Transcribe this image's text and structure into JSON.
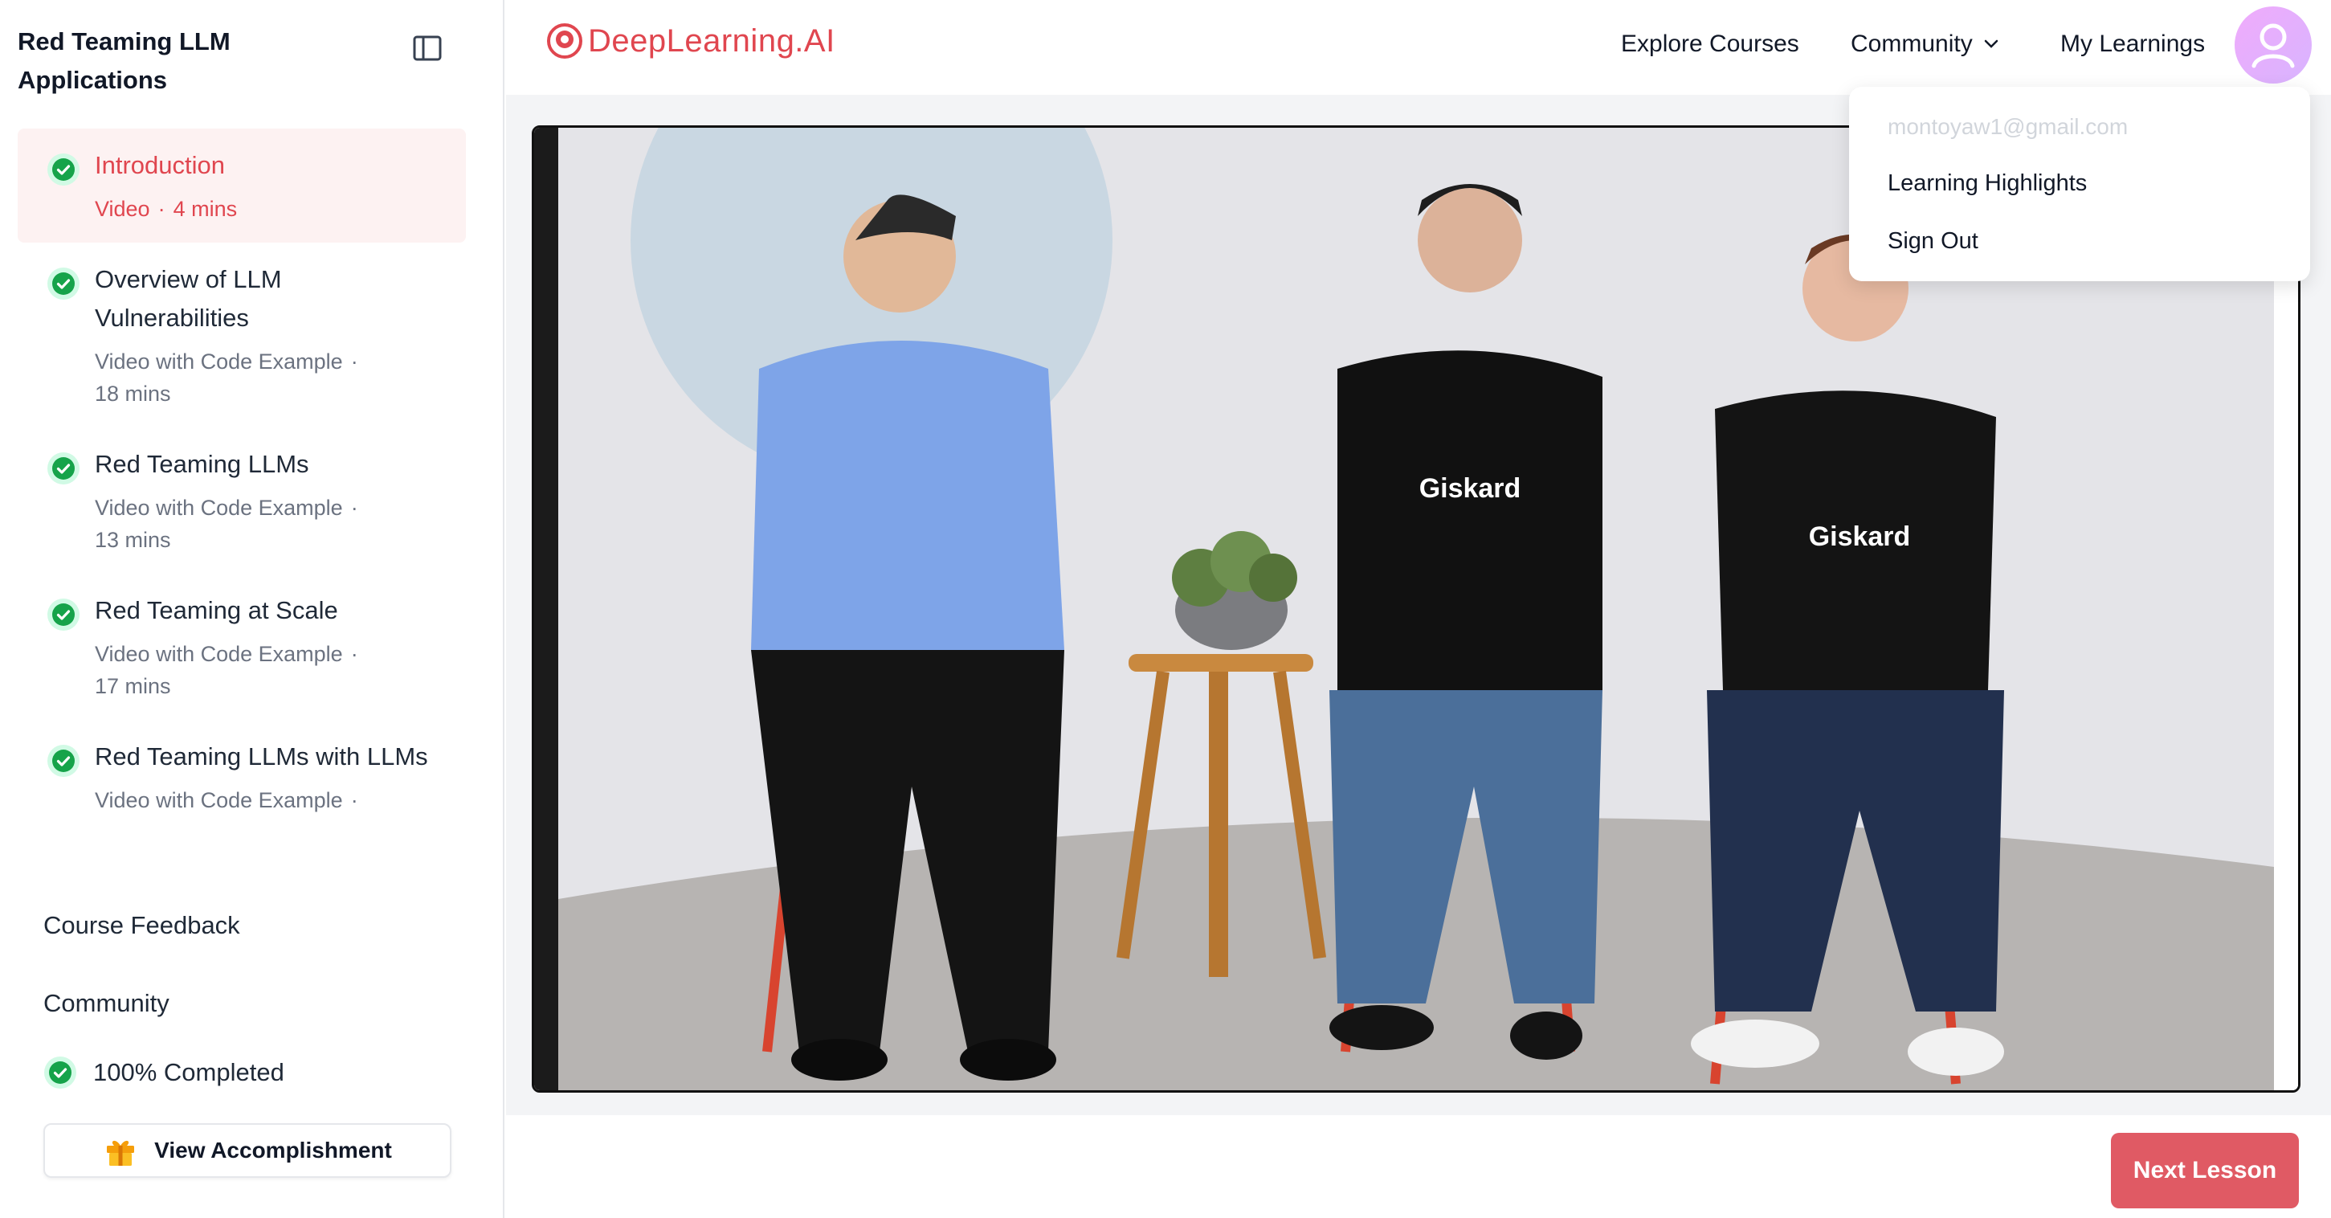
{
  "sidebar": {
    "course_title": "Red Teaming LLM Applications",
    "lessons": [
      {
        "title": "Introduction",
        "meta_type": "Video",
        "meta_duration": "4 mins",
        "completed": true,
        "active": true
      },
      {
        "title": "Overview of LLM Vulnerabilities",
        "meta_type": "Video with Code Example",
        "meta_duration": "18 mins",
        "completed": true
      },
      {
        "title": "Red Teaming LLMs",
        "meta_type": "Video with Code Example",
        "meta_duration": "13 mins",
        "completed": true
      },
      {
        "title": "Red Teaming at Scale",
        "meta_type": "Video with Code Example",
        "meta_duration": "17 mins",
        "completed": true
      },
      {
        "title": "Red Teaming LLMs with LLMs",
        "meta_type": "Video with Code Example",
        "meta_duration": "",
        "completed": true
      }
    ],
    "course_feedback": "Course Feedback",
    "community": "Community",
    "progress": "100% Completed",
    "view_accomplishment": "View Accomplishment"
  },
  "header": {
    "logo": "DeepLearning.AI",
    "nav": {
      "explore": "Explore Courses",
      "community": "Community",
      "my_learnings": "My Learnings"
    }
  },
  "dropdown": {
    "email": "montoyaw1@gmail.com",
    "learning_highlights": "Learning Highlights",
    "sign_out": "Sign Out"
  },
  "video": {
    "shirt_brand": "Giskard"
  },
  "footer": {
    "next_lesson": "Next Lesson"
  },
  "colors": {
    "accent": "#e0464f",
    "next_button": "#e05a64",
    "check_green": "#16a34a"
  }
}
